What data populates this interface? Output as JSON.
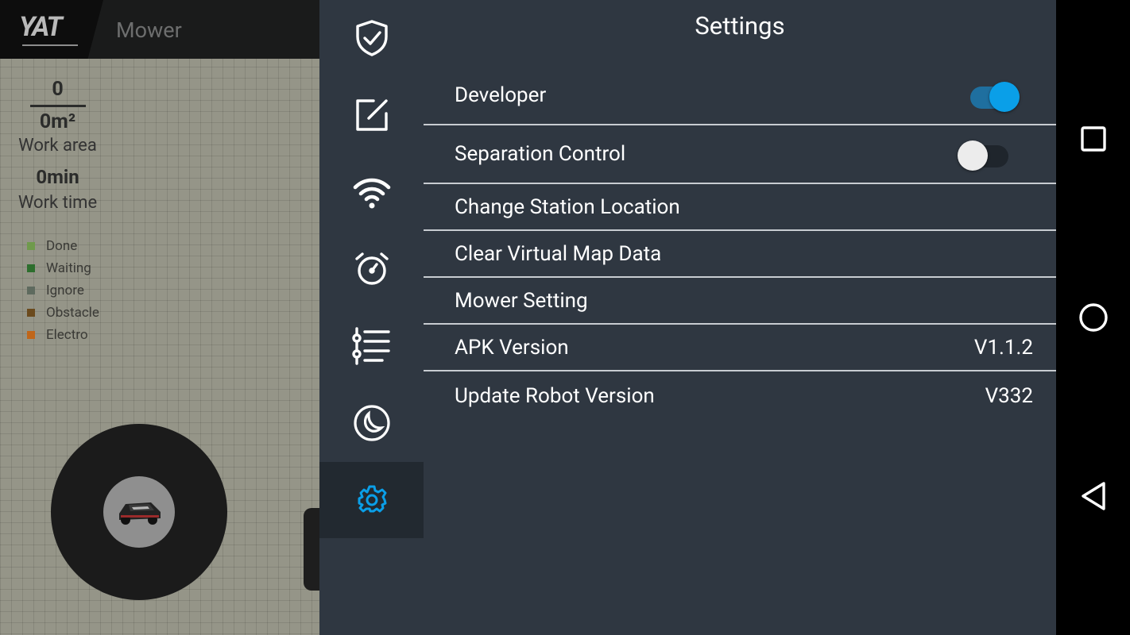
{
  "app": {
    "logo": "YAT",
    "title": "Mower",
    "stats": {
      "count": "0",
      "area": "0m²",
      "area_label": "Work area",
      "time": "0min",
      "time_label": "Work time"
    },
    "legend": [
      {
        "label": "Done",
        "color": "#6f9a4c"
      },
      {
        "label": "Waiting",
        "color": "#2d6e2d"
      },
      {
        "label": "Ignore",
        "color": "#5e6a5e"
      },
      {
        "label": "Obstacle",
        "color": "#6b4a1d"
      },
      {
        "label": "Electro",
        "color": "#c0661a"
      }
    ]
  },
  "rail": {
    "items": [
      {
        "icon": "shield-check-icon"
      },
      {
        "icon": "edit-icon"
      },
      {
        "icon": "wifi-icon"
      },
      {
        "icon": "alarm-clock-icon"
      },
      {
        "icon": "list-icon"
      },
      {
        "icon": "moon-icon"
      },
      {
        "icon": "gear-icon",
        "active": true
      }
    ]
  },
  "settings": {
    "title": "Settings",
    "developer_label": "Developer",
    "developer_on": true,
    "separation_label": "Separation Control",
    "separation_on": false,
    "change_station_label": "Change Station Location",
    "clear_map_label": "Clear Virtual Map Data",
    "mower_setting_label": "Mower Setting",
    "apk_label": "APK Version",
    "apk_value": "V1.1.2",
    "robot_label": "Update Robot Version",
    "robot_value": "V332"
  },
  "colors": {
    "accent": "#0a9fe8",
    "panel_bg": "#2f3741",
    "active_rail": "#222930"
  },
  "navbar": {
    "items": [
      "recent-apps-icon",
      "home-icon",
      "back-icon"
    ]
  }
}
